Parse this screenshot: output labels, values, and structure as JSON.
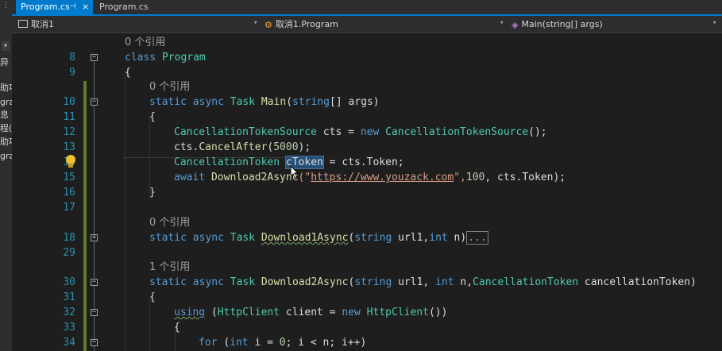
{
  "tabs": [
    {
      "label": "Program.cs",
      "active": true
    },
    {
      "label": "Program.cs",
      "active": false
    }
  ],
  "nav": {
    "project": "取消1",
    "class": "取消1.Program",
    "member": "Main(string[] args)"
  },
  "left_fragments": [
    "异",
    "助项",
    "gra",
    "息",
    "程(",
    "助项",
    "gra"
  ],
  "lens": {
    "program": "0 个引用",
    "main": "0 个引用",
    "download1": "0 个引用",
    "download2": "1 个引用"
  },
  "line_numbers": [
    "8",
    "9",
    "10",
    "11",
    "12",
    "13",
    "14",
    "15",
    "16",
    "17",
    "18",
    "29",
    "30",
    "31",
    "32",
    "33",
    "34"
  ],
  "code": {
    "l8_kw": "class",
    "l8_name": "Program",
    "l9": "{",
    "l10_kw1": "static",
    "l10_kw2": "async",
    "l10_type": "Task",
    "l10_name": "Main",
    "l10_param_kw": "string",
    "l10_param_rest": "[] args)",
    "l11": "{",
    "l12_type": "CancellationTokenSource",
    "l12_var": " cts = ",
    "l12_new": "new",
    "l12_type2": "CancellationTokenSource",
    "l12_end": "();",
    "l13_obj": "cts.",
    "l13_method": "CancelAfter",
    "l13_num": "5000",
    "l13_end": ");",
    "l14_type": "CancellationToken",
    "l14_var": "cToken",
    "l14_end": " = cts.Token;",
    "l15_kw": "await",
    "l15_method": "Download2Async",
    "l15_open": "(\"",
    "l15_url": "https://www.youzack.com",
    "l15_close": "\",",
    "l15_num": "100",
    "l15_end": ", cts.Token);",
    "l16": "}",
    "l18_kw1": "static",
    "l18_kw2": "async",
    "l18_type": "Task",
    "l18_name": "Download1Async",
    "l18_kw3": "string",
    "l18_mid": " url1,",
    "l18_kw4": "int",
    "l18_end": " n)",
    "l18_collapsed": "...",
    "l30_kw1": "static",
    "l30_kw2": "async",
    "l30_type": "Task",
    "l30_name": "Download2Async",
    "l30_kw3": "string",
    "l30_mid": " url1, ",
    "l30_kw4": "int",
    "l30_mid2": " n,",
    "l30_type2": "CancellationToken",
    "l30_end": " cancellationToken)",
    "l31": "{",
    "l32_kw": "using",
    "l32_type": "HttpClient",
    "l32_var": " client = ",
    "l32_new": "new",
    "l32_type2": "HttpClient",
    "l32_end": "())",
    "l33": "{",
    "l34_kw": "for",
    "l34_kw2": "int",
    "l34_rest": " i = ",
    "l34_num": "0",
    "l34_end": "; i < n; i++)"
  }
}
